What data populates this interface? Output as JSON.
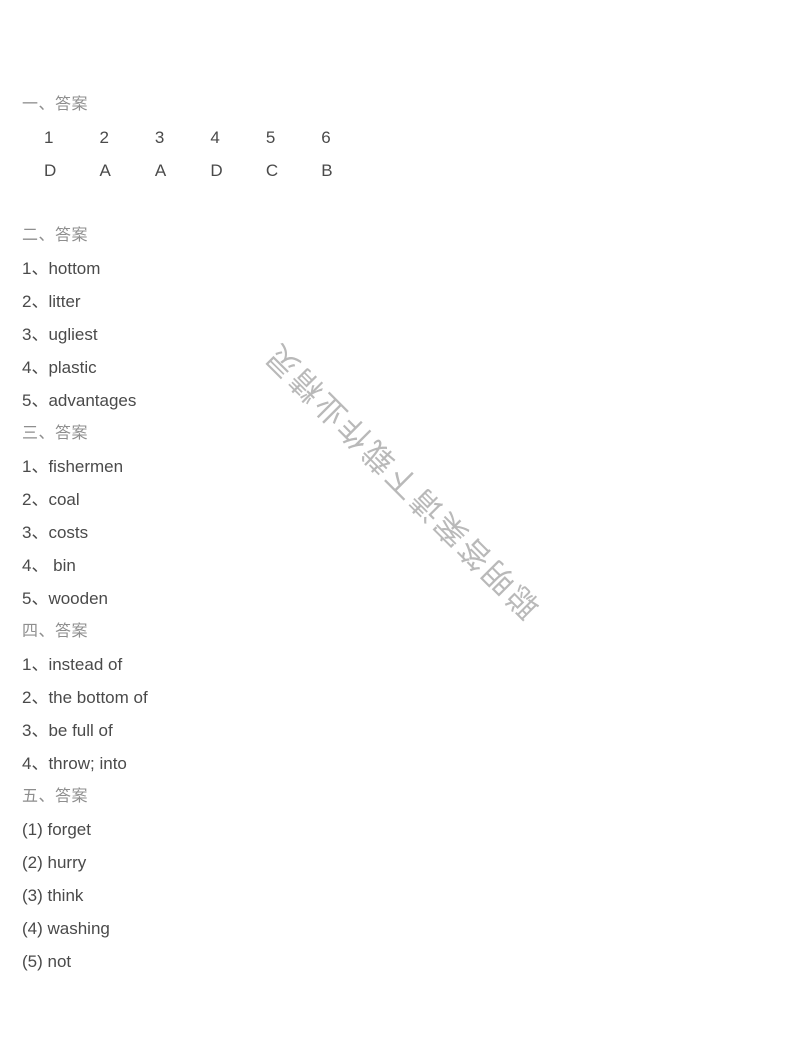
{
  "watermark": {
    "text": "聪明答案请下载作业精灵",
    "color": "#b9b9b9",
    "rotation_deg": 225
  },
  "colors": {
    "page_background": "#ffffff",
    "heading_text": "#8e8e8e",
    "body_text": "#4a4a4a"
  },
  "sections": [
    {
      "heading": "一、答案",
      "type": "choice-grid",
      "numbers": [
        "1",
        "2",
        "3",
        "4",
        "5",
        "6"
      ],
      "answers": [
        "D",
        "A",
        "A",
        "D",
        "C",
        "B"
      ]
    },
    {
      "heading": "二、答案",
      "type": "list",
      "items": [
        "1、hottom",
        "2、litter",
        "3、ugliest",
        "4、plastic",
        "5、advantages"
      ]
    },
    {
      "heading": "三、答案",
      "type": "list",
      "items": [
        "1、fishermen",
        "2、coal",
        "3、costs",
        "4、 bin",
        "5、wooden"
      ]
    },
    {
      "heading": "四、答案",
      "type": "list",
      "items": [
        "1、instead of",
        "2、the bottom of",
        "3、be full of",
        "4、throw; into"
      ]
    },
    {
      "heading": "五、答案",
      "type": "list",
      "items": [
        "(1) forget",
        "(2) hurry",
        "(3) think",
        "(4) washing",
        "(5) not"
      ]
    }
  ]
}
